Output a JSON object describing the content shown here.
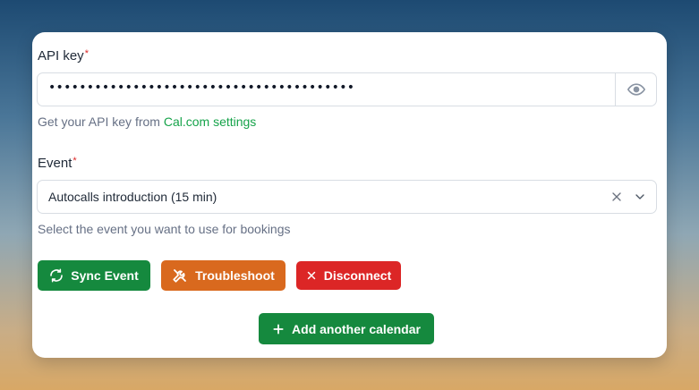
{
  "form": {
    "api_key": {
      "label": "API key",
      "required_mark": "*",
      "value": "••••••••••••••••••••••••••••••••••••••••",
      "toggle_icon": "eye-icon",
      "help_prefix": "Get your API key from ",
      "help_link": "Cal.com settings"
    },
    "event": {
      "label": "Event",
      "required_mark": "*",
      "selected": "Autocalls introduction (15 min)",
      "help": "Select the event you want to use for bookings",
      "clear_icon": "close-icon",
      "dropdown_icon": "chevron-down-icon"
    }
  },
  "actions": {
    "sync_label": "Sync Event",
    "troubleshoot_label": "Troubleshoot",
    "disconnect_label": "Disconnect",
    "add_calendar_label": "Add another calendar"
  },
  "colors": {
    "accent_green": "#16a34a",
    "sync_button": "#15893e",
    "troubleshoot_button": "#d9691e",
    "disconnect_button": "#dc2626",
    "required_mark": "#dc2626"
  }
}
